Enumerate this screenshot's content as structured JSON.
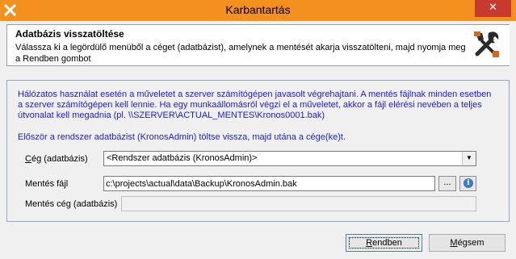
{
  "window": {
    "title": "Karbantartás",
    "close_symbol": "✕",
    "app_icon": "close-x-icon"
  },
  "header": {
    "title": "Adatbázis visszatöltése",
    "description": "Válassza ki a legördülő menüből a céget (adatbázist), amelynek a mentését akarja visszatölteni, majd nyomja meg a Rendben gombot",
    "icon": "tools-icon"
  },
  "info": {
    "paragraph": "Hálózatos használat esetén a műveletet a szerver számítógépen javasolt végrehajtani. A mentés fájlnak minden esetben a szerver számítógépen kell lennie. Ha egy munkaállomásról végzi el a műveletet, akkor a fájl elérési nevében a teljes útvonalat kell megadnia (pl. \\\\SZERVER\\ACTUAL_MENTES\\Kronos0001.bak)",
    "first_step": "Először a rendszer adatbázist (KronosAdmin) töltse vissza, majd utána a cége(ke)t."
  },
  "form": {
    "company_label_u": "C",
    "company_label_rest": "ég (adatbázis)",
    "company_selected": "<Rendszer adatbázis (KronosAdmin)>",
    "file_label_pre": "Mentés fá",
    "file_label_u": "j",
    "file_label_post": "l",
    "file_value": "c:\\projects\\actual\\data\\Backup\\KronosAdmin.bak",
    "browse_label": "...",
    "info_symbol": "i",
    "backup_company_label": "Mentés cég (adatbázis)",
    "backup_company_value": ""
  },
  "buttons": {
    "ok_u": "R",
    "ok_rest": "endben",
    "cancel_u": "M",
    "cancel_rest": "égsem"
  }
}
